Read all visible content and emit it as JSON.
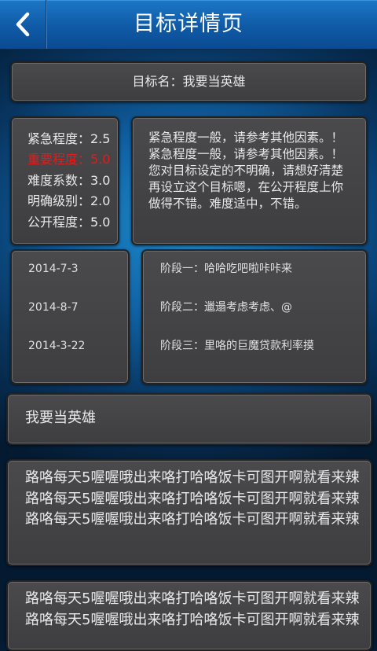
{
  "header": {
    "title": "目标详情页",
    "back_icon": "chevron-left-icon"
  },
  "goal": {
    "name_label": "目标名：我要当英雄"
  },
  "scores": [
    {
      "label": "紧急程度：2.5",
      "highlight": false
    },
    {
      "label": "重要程度：5.0",
      "highlight": true
    },
    {
      "label": "难度系数：3.0",
      "highlight": false
    },
    {
      "label": "明确级别：2.0",
      "highlight": false
    },
    {
      "label": "公开程度：5.0",
      "highlight": false
    }
  ],
  "advice": "紧急程度一般，请参考其他因素。！紧急程度一般，请参考其他因素。！您对目标设定的不明确，请想好清楚再设立这个目标嗯，在公开程度上你做得不错。难度适中，不错。",
  "dates": [
    "2014-7-3",
    "2014-8-7",
    "2014-3-22"
  ],
  "stages": [
    "阶段一：哈哈吃吧啦咔咔来",
    "阶段二：邋遢考虑考虑、@",
    "阶段三：里咯的巨魔贷款利率摸"
  ],
  "hero_text": "我要当英雄",
  "paragraphs": [
    "路咯每天5喔喔哦出来咯打哈咯饭卡可图开啊就看来辣路咯每天5喔喔哦出来咯打哈咯饭卡可图开啊就看来辣路咯每天5喔喔哦出来咯打哈咯饭卡可图开啊就看来辣",
    "路咯每天5喔喔哦出来咯打哈咯饭卡可图开啊就看来辣路咯每天5喔喔哦出来咯打哈咯饭卡可图开啊就看来辣"
  ],
  "colors": {
    "title_bar": "#0f5aa6",
    "highlight_red": "#e21c1c",
    "panel_bg": "#444446"
  }
}
